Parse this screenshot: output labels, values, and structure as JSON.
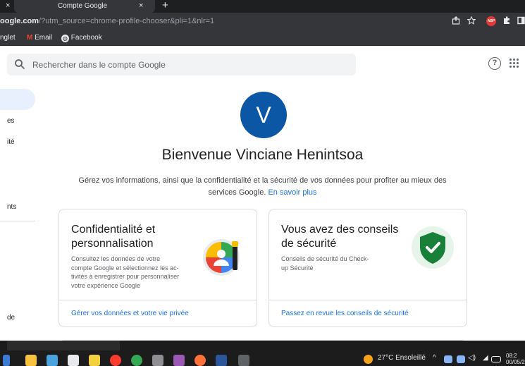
{
  "browser": {
    "tab_title": "Compte Google",
    "tab_close_left": "×",
    "tab_close": "×",
    "new_tab": "+",
    "url_host": "oogle.com",
    "url_rest": "/?utm_source=chrome-profile-chooser&pli=1&nlr=1",
    "bookmarks": [
      {
        "label": "nglet"
      },
      {
        "label": "Email",
        "icon": "gmail-icon"
      },
      {
        "label": "Facebook",
        "icon": "globe-icon"
      }
    ],
    "extension_label": "ABP"
  },
  "header": {
    "search_placeholder": "Rechercher dans le compte Google",
    "help_glyph": "?"
  },
  "nav": {
    "items": [
      {
        "label": "es"
      },
      {
        "label": "ité"
      },
      {
        "label": "nts"
      },
      {
        "label": "de"
      }
    ]
  },
  "main": {
    "avatar_letter": "V",
    "welcome": "Bienvenue Vinciane Henintsoa",
    "intro_text": "Gérez vos informations, ainsi que la confidentialité et la sécurité de vos données pour profiter au mieux des services Google.",
    "intro_link": "En savoir plus"
  },
  "cards": [
    {
      "title_line1": "Confidentialité et",
      "title_line2": "personnalisation",
      "desc_lines": [
        "Consultez les données de votre",
        "compte Google et sélectionnez les ac-",
        "tivités à enregistrer pour personnaliser",
        "votre expérience Google"
      ],
      "link": "Gérer vos données et votre vie privée",
      "icon": "privacy-illustration-icon"
    },
    {
      "title_line1": "Vous avez des conseils",
      "title_line2": "de sécurité",
      "desc_lines": [
        "Conseils de sécurité du Check-",
        "up Sécurité"
      ],
      "link": "Passez en revue les conseils de sécurité",
      "icon": "security-shield-icon"
    }
  ],
  "taskbar": {
    "weather": "27°C  Ensoleillé",
    "time": "08:2",
    "date": "00/05/2"
  },
  "colors": {
    "accent": "#1a73e8",
    "avatar": "#0b57a5",
    "shield": "#188038"
  }
}
